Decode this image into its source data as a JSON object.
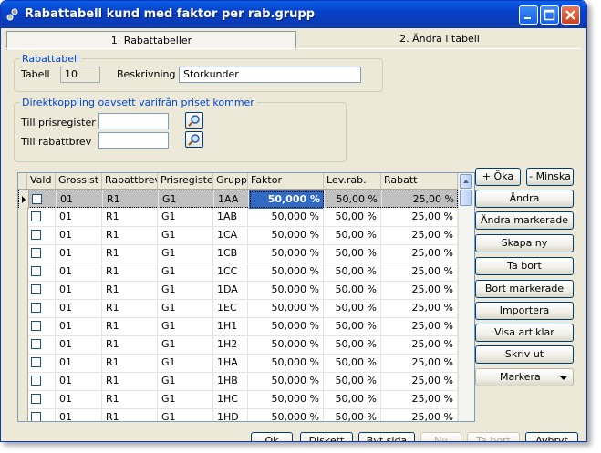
{
  "window": {
    "title": "Rabattabell kund med faktor per rab.grupp"
  },
  "tabs": [
    {
      "label": "1. Rabattabeller"
    },
    {
      "label": "2. Ändra i tabell"
    }
  ],
  "rabattabell": {
    "legend": "Rabattabell",
    "tabell_label": "Tabell",
    "tabell_value": "10",
    "beskrivning_label": "Beskrivning",
    "beskrivning_value": "Storkunder"
  },
  "direktkoppling": {
    "legend": "Direktkoppling oavsett varifrån priset kommer",
    "prisregister_label": "Till prisregister",
    "prisregister_value": "",
    "rabattbrev_label": "Till rabattbrev",
    "rabattbrev_value": ""
  },
  "grid": {
    "columns": [
      "Vald",
      "Grossist",
      "Rabattbrev",
      "Prisregister",
      "Grupp",
      "Faktor",
      "Lev.rab.",
      "Rabatt"
    ],
    "rows": [
      {
        "grossist": "01",
        "rabattbrev": "R1",
        "prisregister": "G1",
        "grupp": "1AA",
        "faktor": "50,000 %",
        "levrab": "50,00 %",
        "rabatt": "25,00 %"
      },
      {
        "grossist": "01",
        "rabattbrev": "R1",
        "prisregister": "G1",
        "grupp": "1AB",
        "faktor": "50,000 %",
        "levrab": "50,00 %",
        "rabatt": "25,00 %"
      },
      {
        "grossist": "01",
        "rabattbrev": "R1",
        "prisregister": "G1",
        "grupp": "1CA",
        "faktor": "50,000 %",
        "levrab": "50,00 %",
        "rabatt": "25,00 %"
      },
      {
        "grossist": "01",
        "rabattbrev": "R1",
        "prisregister": "G1",
        "grupp": "1CB",
        "faktor": "50,000 %",
        "levrab": "50,00 %",
        "rabatt": "25,00 %"
      },
      {
        "grossist": "01",
        "rabattbrev": "R1",
        "prisregister": "G1",
        "grupp": "1CC",
        "faktor": "50,000 %",
        "levrab": "50,00 %",
        "rabatt": "25,00 %"
      },
      {
        "grossist": "01",
        "rabattbrev": "R1",
        "prisregister": "G1",
        "grupp": "1DA",
        "faktor": "50,000 %",
        "levrab": "50,00 %",
        "rabatt": "25,00 %"
      },
      {
        "grossist": "01",
        "rabattbrev": "R1",
        "prisregister": "G1",
        "grupp": "1EC",
        "faktor": "50,000 %",
        "levrab": "50,00 %",
        "rabatt": "25,00 %"
      },
      {
        "grossist": "01",
        "rabattbrev": "R1",
        "prisregister": "G1",
        "grupp": "1H1",
        "faktor": "50,000 %",
        "levrab": "50,00 %",
        "rabatt": "25,00 %"
      },
      {
        "grossist": "01",
        "rabattbrev": "R1",
        "prisregister": "G1",
        "grupp": "1H2",
        "faktor": "50,000 %",
        "levrab": "50,00 %",
        "rabatt": "25,00 %"
      },
      {
        "grossist": "01",
        "rabattbrev": "R1",
        "prisregister": "G1",
        "grupp": "1HA",
        "faktor": "50,000 %",
        "levrab": "50,00 %",
        "rabatt": "25,00 %"
      },
      {
        "grossist": "01",
        "rabattbrev": "R1",
        "prisregister": "G1",
        "grupp": "1HB",
        "faktor": "50,000 %",
        "levrab": "50,00 %",
        "rabatt": "25,00 %"
      },
      {
        "grossist": "01",
        "rabattbrev": "R1",
        "prisregister": "G1",
        "grupp": "1HC",
        "faktor": "50,000 %",
        "levrab": "50,00 %",
        "rabatt": "25,00 %"
      },
      {
        "grossist": "01",
        "rabattbrev": "R1",
        "prisregister": "G1",
        "grupp": "1HD",
        "faktor": "50,000 %",
        "levrab": "50,00 %",
        "rabatt": "25,00 %"
      }
    ]
  },
  "side_buttons": {
    "oka": "+ Öka",
    "minska": "- Minska",
    "andra": "Ändra",
    "andra_markerade": "Ändra markerade",
    "skapa_ny": "Skapa ny",
    "ta_bort": "Ta bort",
    "bort_markerade": "Bort markerade",
    "importera": "Importera",
    "visa_artiklar": "Visa artiklar",
    "skriv_ut": "Skriv ut",
    "markera": "Markera"
  },
  "bottom_buttons": {
    "ok": "Ok",
    "diskett": "Diskett",
    "byt_sida": "Byt sida",
    "ny": "Ny",
    "ta_bort": "Ta bort",
    "avbryt": "Avbryt"
  },
  "colors": {
    "titlebar": "#0a5fe8",
    "window_bg": "#ece9d8",
    "legend_text": "#0046d5",
    "selected_cell": "#316ac5"
  }
}
